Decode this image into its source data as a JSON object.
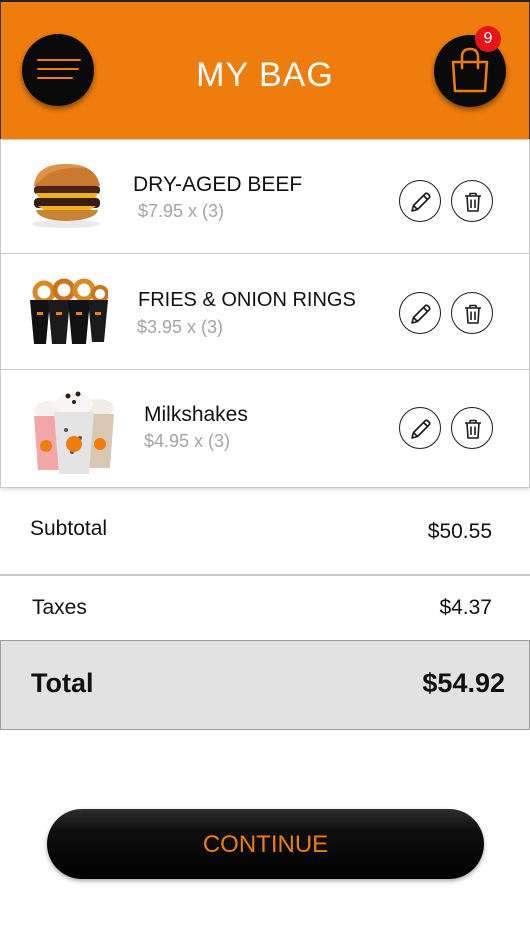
{
  "header": {
    "title": "MY BAG",
    "cart_count": "9",
    "menu_icon": "hamburger-menu-icon",
    "cart_icon": "shopping-bag-icon"
  },
  "colors": {
    "accent": "#ef7d0e",
    "badge": "#e8141c",
    "button_dark": "#000000",
    "total_bg": "#e2e2e2"
  },
  "items": [
    {
      "name": "DRY-AGED BEEF",
      "price": "$7.95 x (3)",
      "image": "burger-image",
      "edit_icon": "pencil-icon",
      "delete_icon": "trash-icon"
    },
    {
      "name": "FRIES & ONION RINGS",
      "price": "$3.95 x (3)",
      "image": "fries-onion-rings-image",
      "edit_icon": "pencil-icon",
      "delete_icon": "trash-icon"
    },
    {
      "name": "Milkshakes",
      "price": "$4.95 x (3)",
      "image": "milkshakes-image",
      "edit_icon": "pencil-icon",
      "delete_icon": "trash-icon"
    }
  ],
  "summary": {
    "subtotal_label": "Subtotal",
    "subtotal_value": "$50.55",
    "taxes_label": "Taxes",
    "taxes_value": "$4.37",
    "total_label": "Total",
    "total_value": "$54.92"
  },
  "continue_label": "CONTINUE"
}
